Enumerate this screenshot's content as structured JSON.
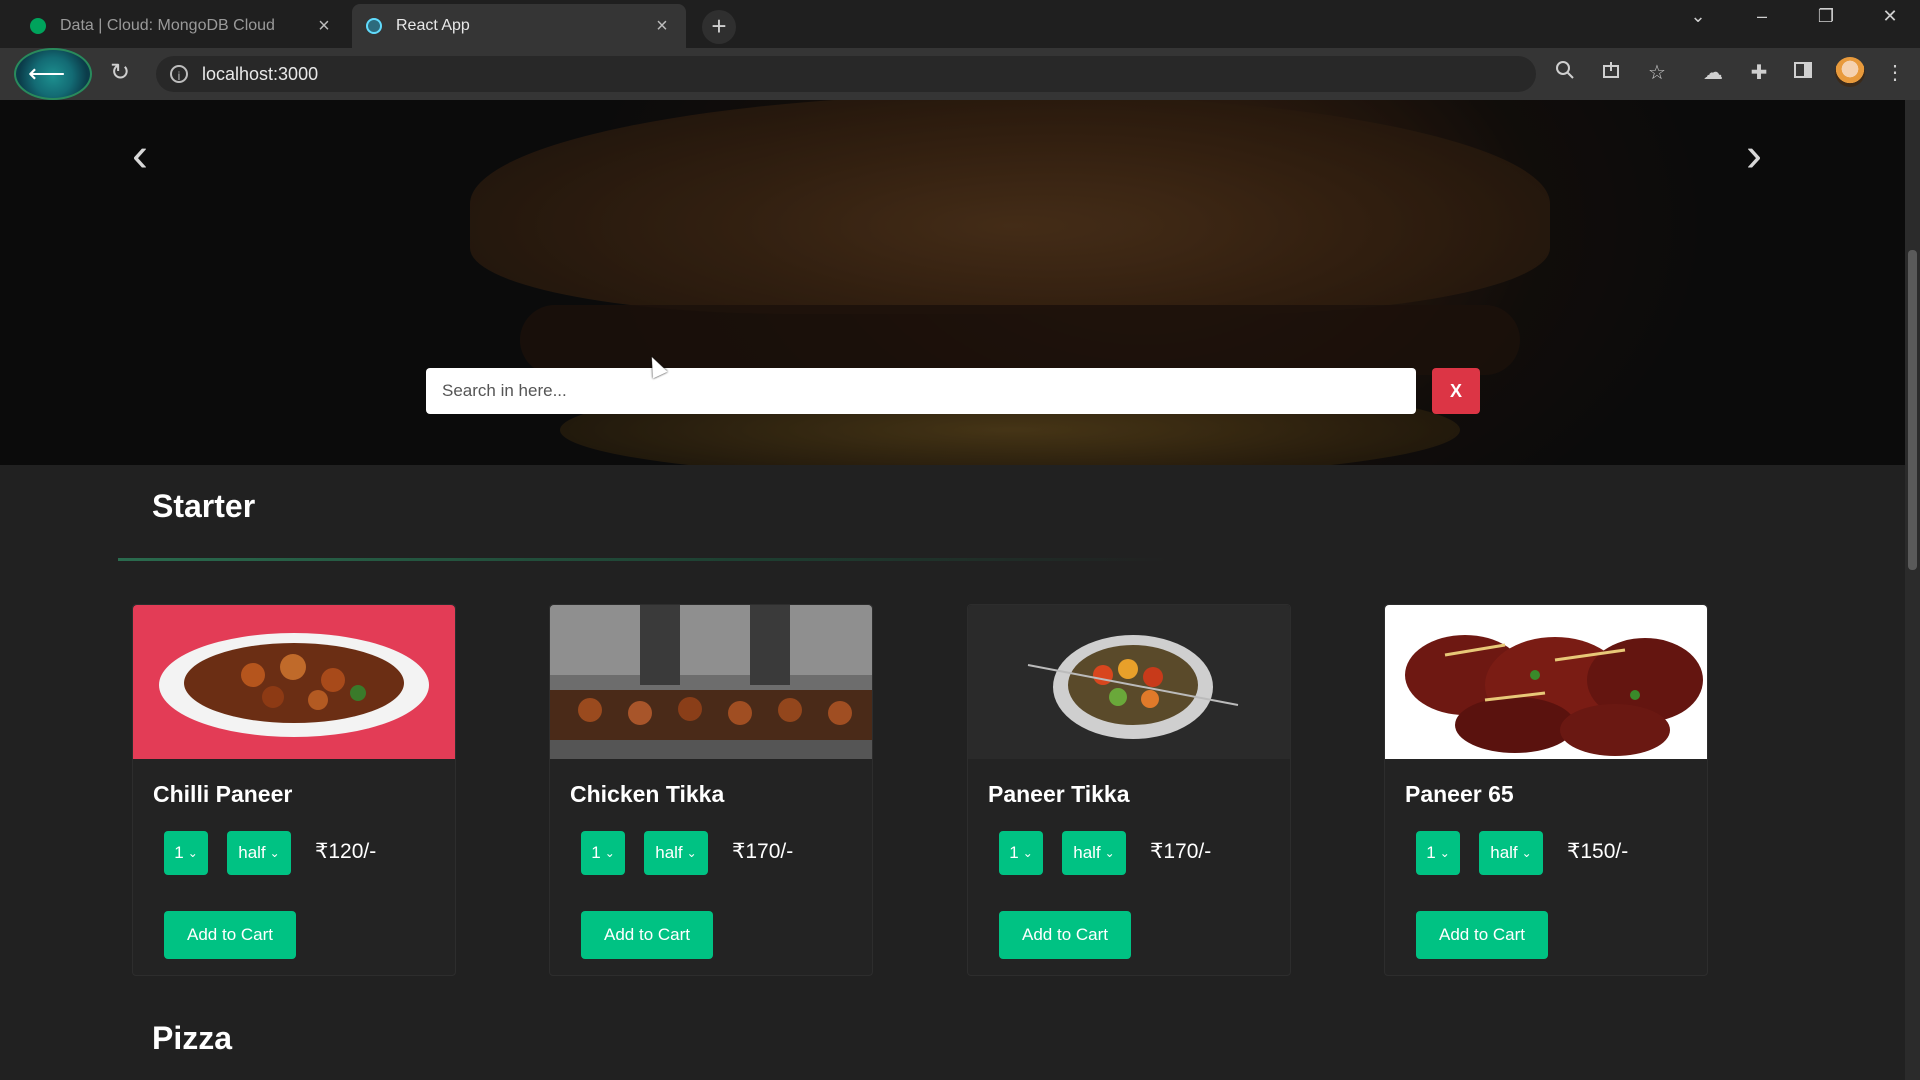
{
  "browser": {
    "tabs": [
      {
        "title": "Data | Cloud: MongoDB Cloud",
        "active": false,
        "favicon_color": "#00a35c"
      },
      {
        "title": "React App",
        "active": true,
        "favicon_color": "#61dafb"
      }
    ],
    "tab_close": "×",
    "new_tab": "+",
    "url": "localhost:3000",
    "window_controls": {
      "dropdown": "⌄",
      "minimize": "–",
      "restore": "❐",
      "close": "✕"
    },
    "icons": [
      "zoom-icon",
      "share-icon",
      "bookmark-star-icon",
      "cloud-extension-icon",
      "puzzle-extension-icon",
      "side-panel-icon",
      "profile-avatar",
      "kebab-menu-icon"
    ]
  },
  "hero": {
    "prev": "‹",
    "next": "›",
    "search": {
      "placeholder": "Search in here...",
      "value": ""
    },
    "clear_label": "X"
  },
  "sections": [
    {
      "title": "Starter",
      "items": [
        {
          "name": "Chilli Paneer",
          "qty": "1",
          "size": "half",
          "price": "₹120/-",
          "cart": "Add to Cart"
        },
        {
          "name": "Chicken Tikka",
          "qty": "1",
          "size": "half",
          "price": "₹170/-",
          "cart": "Add to Cart"
        },
        {
          "name": "Paneer Tikka",
          "qty": "1",
          "size": "half",
          "price": "₹170/-",
          "cart": "Add to Cart"
        },
        {
          "name": "Paneer 65",
          "qty": "1",
          "size": "half",
          "price": "₹150/-",
          "cart": "Add to Cart"
        }
      ]
    },
    {
      "title": "Pizza",
      "items": []
    }
  ],
  "colors": {
    "accent": "#00c283",
    "danger": "#dc3545",
    "background": "#212121"
  }
}
